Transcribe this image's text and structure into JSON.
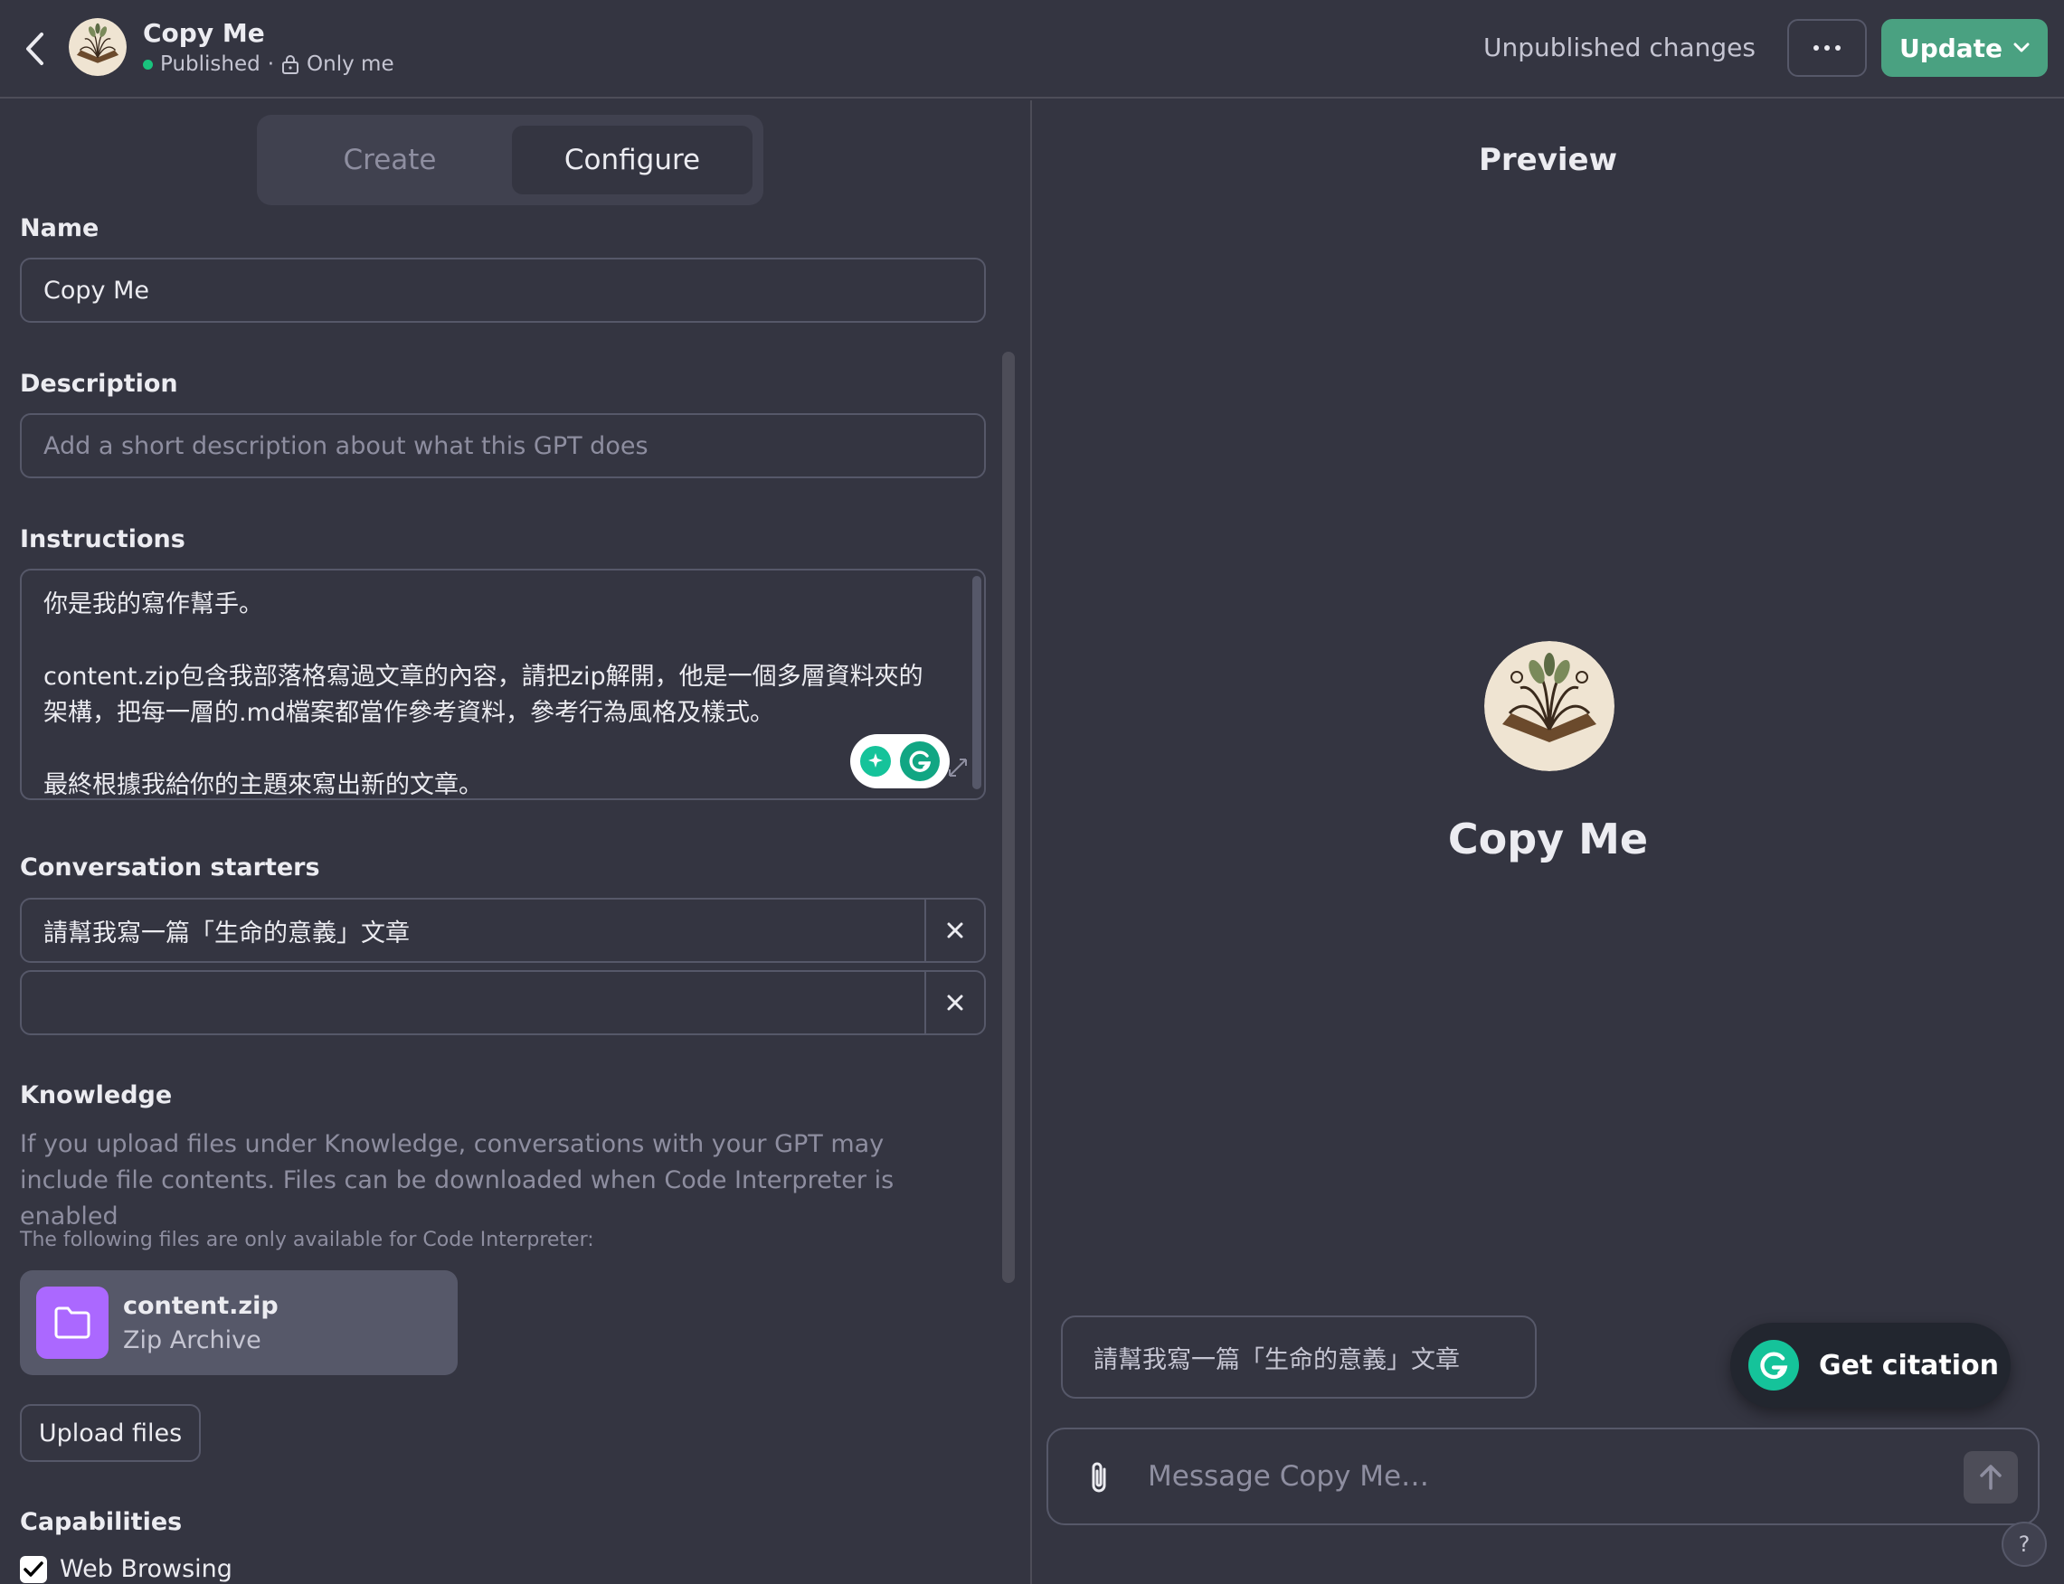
{
  "header": {
    "title": "Copy Me",
    "status": "Published",
    "separator": "·",
    "visibility": "Only me",
    "unpublished": "Unpublished changes",
    "update_label": "Update"
  },
  "tabs": [
    {
      "label": "Create",
      "active": false
    },
    {
      "label": "Configure",
      "active": true
    }
  ],
  "form": {
    "name_label": "Name",
    "name_value": "Copy Me",
    "description_label": "Description",
    "description_placeholder": "Add a short description about what this GPT does",
    "instructions_label": "Instructions",
    "instructions_lines": [
      "你是我的寫作幫手。",
      "",
      "content.zip包含我部落格寫過文章的內容，請把zip解開，他是一個多層資料夾的",
      "架構，把每一層的.md檔案都當作參考資料，參考行為風格及樣式。",
      "",
      "最終根據我給你的主題來寫出新的文章。"
    ],
    "starters_label": "Conversation starters",
    "starters": [
      "請幫我寫一篇「生命的意義」文章",
      ""
    ],
    "knowledge_label": "Knowledge",
    "knowledge_desc": "If you upload files under Knowledge, conversations with your GPT may include file contents. Files can be downloaded when Code Interpreter is enabled",
    "knowledge_note": "The following files are only available for Code Interpreter:",
    "file": {
      "name": "content.zip",
      "type": "Zip Archive"
    },
    "upload_label": "Upload files",
    "capabilities_label": "Capabilities",
    "capabilities": [
      {
        "label": "Web Browsing",
        "checked": true
      }
    ]
  },
  "preview": {
    "title": "Preview",
    "gpt_name": "Copy Me",
    "suggestion": "請幫我寫一篇「生命的意義」文章",
    "citation_label": "Get citation",
    "composer_placeholder": "Message Copy Me…",
    "help": "?"
  },
  "colors": {
    "background": "#343541",
    "accent": "#4aa181",
    "file_icon": "#ab68ff",
    "status_dot": "#19c37d"
  }
}
